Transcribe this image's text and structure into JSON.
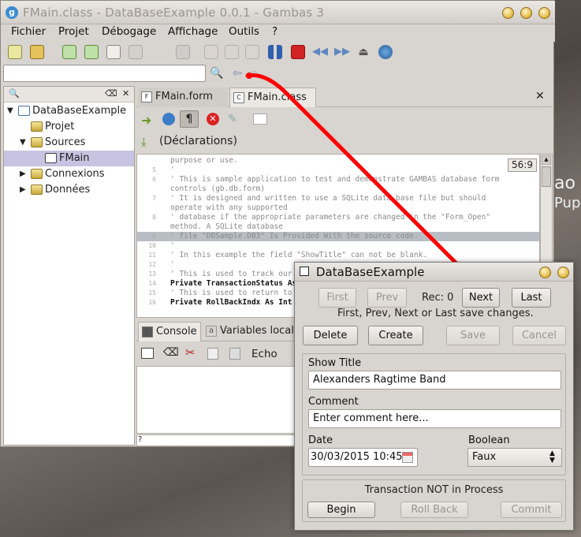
{
  "desktop": {
    "text1": "ao",
    "text2": "Pup"
  },
  "main_window": {
    "title": "FMain.class - DataBaseExample 0.0.1 - Gambas 3",
    "menus": [
      "Fichier",
      "Projet",
      "Débogage",
      "Affichage",
      "Outils",
      "?"
    ],
    "project_tree": {
      "items": [
        {
          "label": "DataBaseExample",
          "level": 0
        },
        {
          "label": "Projet",
          "level": 1
        },
        {
          "label": "Sources",
          "level": 1
        },
        {
          "label": "FMain",
          "level": 2
        },
        {
          "label": "Connexions",
          "level": 1
        },
        {
          "label": "Données",
          "level": 1
        }
      ]
    },
    "editor_tabs": [
      {
        "label": "FMain.form",
        "icon_text": "F"
      },
      {
        "label": "FMain.class",
        "icon_text": "C"
      }
    ],
    "procedure_label": "(Déclarations)",
    "cursor_position": "56:9",
    "code_lines": [
      {
        "ln": "",
        "text": "purpose or use.",
        "kind": "comment"
      },
      {
        "ln": "5",
        "text": "'",
        "kind": "comment"
      },
      {
        "ln": "6",
        "text": "' This is sample application to test and demonstrate GAMBAS database form",
        "kind": "comment"
      },
      {
        "ln": "",
        "text": "controls (gb.db.form)",
        "kind": "comment"
      },
      {
        "ln": "7",
        "text": "' It is designed and written to use a SQLite data base file but should",
        "kind": "comment"
      },
      {
        "ln": "",
        "text": "operate with any supported",
        "kind": "comment"
      },
      {
        "ln": "8",
        "text": "' database if the appropriate parameters are changed in the \"Form_Open\"",
        "kind": "comment"
      },
      {
        "ln": "",
        "text": "method. A SQLite database",
        "kind": "comment"
      },
      {
        "ln": "9",
        "text": "' file \"DBSample.DB3\" Is Provided With the source code.",
        "kind": "highlight"
      },
      {
        "ln": "10",
        "text": "'",
        "kind": "comment"
      },
      {
        "ln": "11",
        "text": "' In this example the field \"ShowTitle\" can not be blank.",
        "kind": "comment"
      },
      {
        "ln": "12",
        "text": "'",
        "kind": "comment"
      },
      {
        "ln": "13",
        "text": "' This is used to track our",
        "kind": "comment"
      },
      {
        "ln": "14",
        "text": "Private TransactionStatus As",
        "kind": "keyword"
      },
      {
        "ln": "15",
        "text": "' This is used to return to",
        "kind": "comment"
      },
      {
        "ln": "16",
        "text": "Private RollBackIndx As Int",
        "kind": "keyword"
      }
    ],
    "console_tabs": [
      "Console",
      "Variables locale"
    ],
    "console_toolbar": {
      "echo_label": "Echo"
    },
    "console_input_prompt": "?"
  },
  "dialog": {
    "title": "DataBaseExample",
    "nav": {
      "first": "First",
      "prev": "Prev",
      "rec": "Rec: 0",
      "next": "Next",
      "last": "Last"
    },
    "hint": "First, Prev, Next or Last save changes.",
    "actions": {
      "delete": "Delete",
      "create": "Create",
      "save": "Save",
      "cancel": "Cancel"
    },
    "fields": {
      "show_title_label": "Show Title",
      "show_title_value": "Alexanders Ragtime Band",
      "comment_label": "Comment",
      "comment_value": "Enter comment here...",
      "date_label": "Date",
      "date_value": "30/03/2015 10:45",
      "boolean_label": "Boolean",
      "boolean_value": "Faux"
    },
    "transaction": {
      "status": "Transaction NOT in Process",
      "begin": "Begin",
      "rollback": "Roll Back",
      "commit": "Commit"
    }
  },
  "colors": {
    "annotation_line": "#ff0000",
    "window_bg": "#d8d4cf",
    "selection": "#c7c3e0"
  }
}
